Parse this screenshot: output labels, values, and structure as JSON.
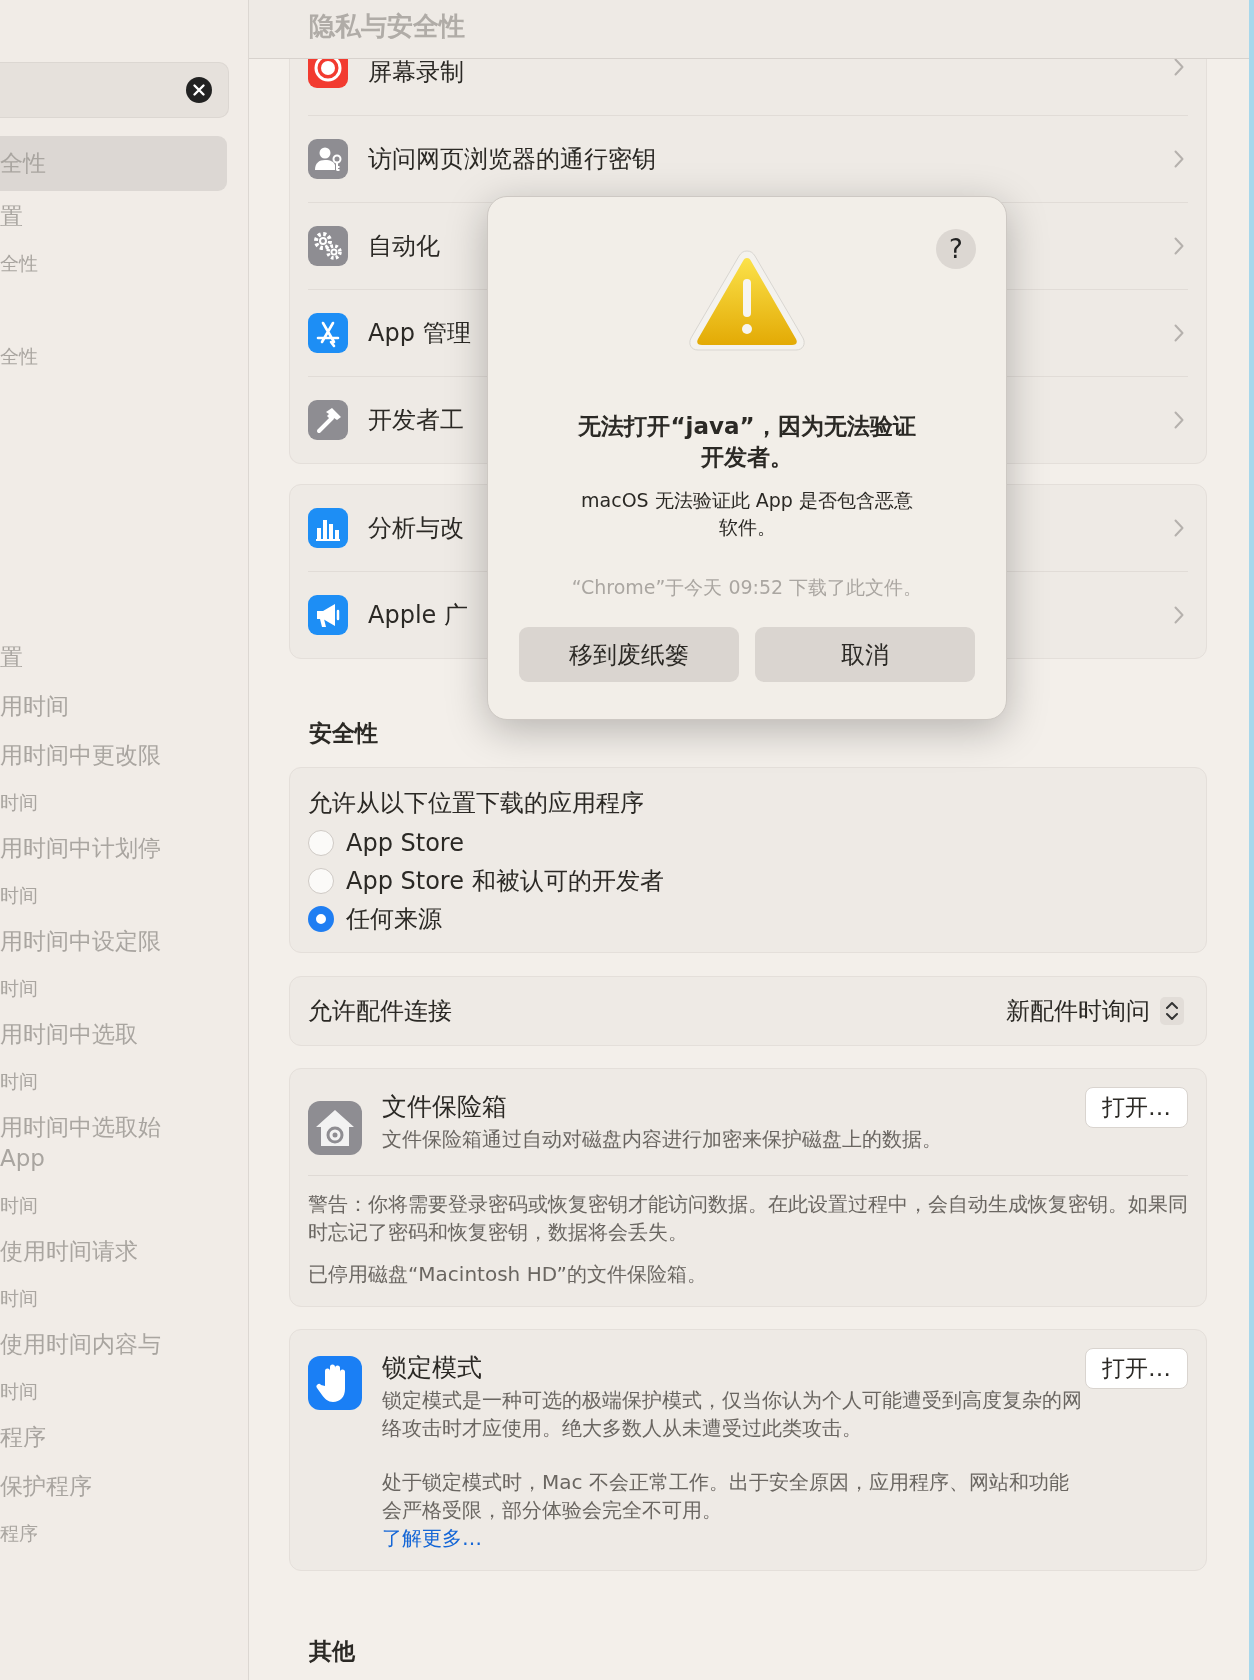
{
  "window": {
    "title": "隐私与安全性"
  },
  "sidebar": {
    "items": [
      {
        "lines": [
          "全性"
        ],
        "selected": true
      },
      {
        "lines": [
          "置"
        ],
        "subtitle": "全性",
        "selected": false
      },
      {
        "subtitle": "全性",
        "selected": false
      },
      {
        "lines": [
          "置"
        ],
        "selected": false
      },
      {
        "lines": [
          "用时间"
        ],
        "selected": false
      },
      {
        "lines": [
          "用时间中更改限"
        ],
        "subtitle": "时间",
        "selected": false
      },
      {
        "lines": [
          "用时间中计划停"
        ],
        "subtitle": "时间",
        "selected": false
      },
      {
        "lines": [
          "用时间中设定限"
        ],
        "subtitle": "时间",
        "selected": false
      },
      {
        "lines": [
          "用时间中选取"
        ],
        "subtitle": "时间",
        "selected": false
      },
      {
        "lines": [
          "用时间中选取始",
          "App"
        ],
        "subtitle": "时间",
        "selected": false
      },
      {
        "lines": [
          "使用时间请求"
        ],
        "subtitle": "时间",
        "selected": false
      },
      {
        "lines": [
          "使用时间内容与"
        ],
        "subtitle": "时间",
        "selected": false
      },
      {
        "lines": [
          "程序"
        ],
        "selected": false
      },
      {
        "lines": [
          "保护程序"
        ],
        "subtitle": "程序",
        "selected": false
      }
    ]
  },
  "privacy_groups": [
    [
      {
        "label": "屏幕录制"
      },
      {
        "label": "访问网页浏览器的通行密钥"
      },
      {
        "label": "自动化"
      },
      {
        "label": "App 管理"
      },
      {
        "label": "开发者工"
      }
    ],
    [
      {
        "label": "分析与改"
      },
      {
        "label": "Apple 广"
      }
    ]
  ],
  "security": {
    "heading": "安全性",
    "download": {
      "label": "允许从以下位置下载的应用程序",
      "options": [
        {
          "label": "App Store",
          "selected": false
        },
        {
          "label": "App Store 和被认可的开发者",
          "selected": false
        },
        {
          "label": "任何来源",
          "selected": true
        }
      ]
    },
    "accessories": {
      "label": "允许配件连接",
      "value": "新配件时询问"
    },
    "filevault": {
      "title": "文件保险箱",
      "description": "文件保险箱通过自动对磁盘内容进行加密来保护磁盘上的数据。",
      "button": "打开…",
      "warning": "警告：你将需要登录密码或恢复密钥才能访问数据。在此设置过程中，会自动生成恢复密钥。如果同时忘记了密码和恢复密钥，数据将会丢失。",
      "status": "已停用磁盘“Macintosh HD”的文件保险箱。"
    },
    "lockdown": {
      "title": "锁定模式",
      "description": "锁定模式是一种可选的极端保护模式，仅当你认为个人可能遭受到高度复杂的网络攻击时才应使用。绝大多数人从未遭受过此类攻击。",
      "description2": "处于锁定模式时，Mac 不会正常工作。出于安全原因，应用程序、网站和功能会严格受限，部分体验会完全不可用。",
      "link": "了解更多…",
      "button": "打开…"
    }
  },
  "other": {
    "heading": "其他"
  },
  "dialog": {
    "title": "无法打开“java”，因为无法验证开发者。",
    "message": "macOS 无法验证此 App 是否包含恶意软件。",
    "note": "“Chrome”于今天 09:52 下载了此文件。",
    "help": "?",
    "buttons": [
      "移到废纸篓",
      "取消"
    ]
  }
}
